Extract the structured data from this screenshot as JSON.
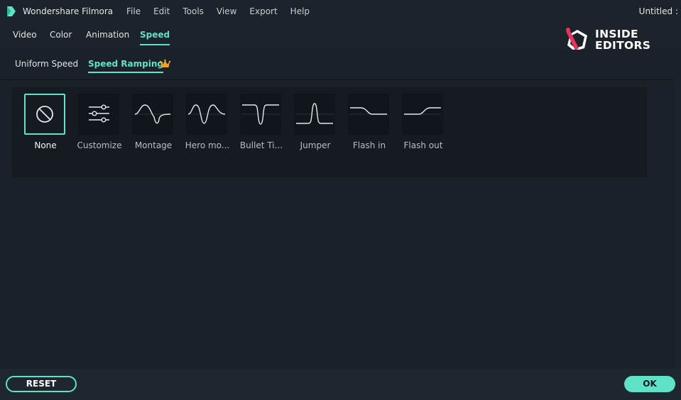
{
  "app": {
    "name": "Wondershare Filmora",
    "document_title": "Untitled :",
    "logo_icon": "filmora-logo-icon"
  },
  "menu": [
    "File",
    "Edit",
    "Tools",
    "View",
    "Export",
    "Help"
  ],
  "main_tabs": [
    {
      "label": "Video",
      "active": false
    },
    {
      "label": "Color",
      "active": false
    },
    {
      "label": "Animation",
      "active": false
    },
    {
      "label": "Speed",
      "active": true
    }
  ],
  "watermark": {
    "line1": "INSIDE",
    "line2": "EDITORS"
  },
  "sub_tabs": [
    {
      "label": "Uniform Speed",
      "active": false
    },
    {
      "label": "Speed Ramping",
      "active": true,
      "badge_icon": "crown-icon"
    }
  ],
  "presets": [
    {
      "label": "None",
      "icon": "none-circle-icon",
      "selected": true
    },
    {
      "label": "Customize",
      "icon": "sliders-icon",
      "selected": false
    },
    {
      "label": "Montage",
      "icon": "montage-curve-icon",
      "selected": false
    },
    {
      "label": "Hero mo...",
      "icon": "hero-moment-curve-icon",
      "selected": false
    },
    {
      "label": "Bullet Ti...",
      "icon": "bullet-time-curve-icon",
      "selected": false
    },
    {
      "label": "Jumper",
      "icon": "jumper-curve-icon",
      "selected": false
    },
    {
      "label": "Flash in",
      "icon": "flash-in-curve-icon",
      "selected": false
    },
    {
      "label": "Flash out",
      "icon": "flash-out-curve-icon",
      "selected": false
    }
  ],
  "buttons": {
    "reset": "RESET",
    "ok": "OK"
  },
  "colors": {
    "accent": "#5fe3c8",
    "background": "#1a2129",
    "panel": "#151b21"
  }
}
